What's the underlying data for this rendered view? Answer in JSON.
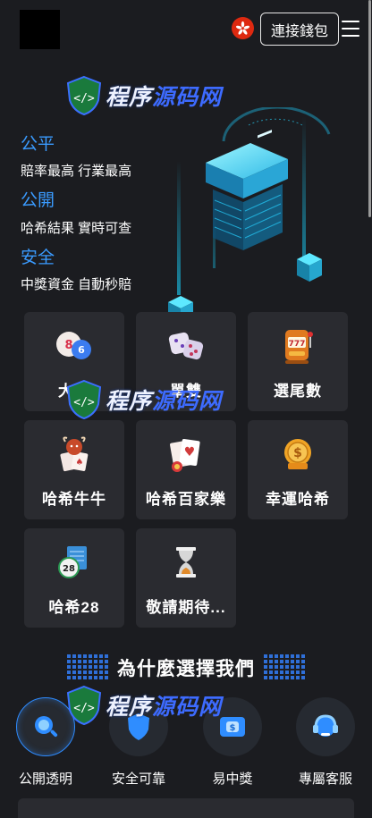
{
  "header": {
    "connect_label": "連接錢包"
  },
  "hero": {
    "items": [
      {
        "title": "公平",
        "desc": "賠率最高 行業最高"
      },
      {
        "title": "公開",
        "desc": "哈希結果 實時可查"
      },
      {
        "title": "安全",
        "desc": "中獎資金 自動秒賠"
      }
    ]
  },
  "watermark": {
    "part1": "程序",
    "part2": "源码网"
  },
  "games": [
    {
      "label": "大小",
      "icon": "lottery-balls-icon"
    },
    {
      "label": "單雙",
      "icon": "dice-icon"
    },
    {
      "label": "選尾數",
      "icon": "slot-machine-icon"
    },
    {
      "label": "哈希牛牛",
      "icon": "bull-cards-icon"
    },
    {
      "label": "哈希百家樂",
      "icon": "baccarat-cards-icon"
    },
    {
      "label": "幸運哈希",
      "icon": "lucky-coin-icon"
    },
    {
      "label": "哈希28",
      "icon": "lottery-28-icon"
    },
    {
      "label": "敬請期待...",
      "icon": "hourglass-icon"
    }
  ],
  "why": {
    "title": "為什麼選擇我們",
    "features": [
      {
        "label": "公開透明",
        "icon": "magnifier-icon"
      },
      {
        "label": "安全可靠",
        "icon": "shield-icon"
      },
      {
        "label": "易中獎",
        "icon": "wallet-icon"
      },
      {
        "label": "專屬客服",
        "icon": "headset-icon"
      }
    ]
  },
  "colors": {
    "accent": "#3a9bff",
    "background": "#1b1c20",
    "card": "#2a2b30",
    "flag": "#de2910"
  }
}
